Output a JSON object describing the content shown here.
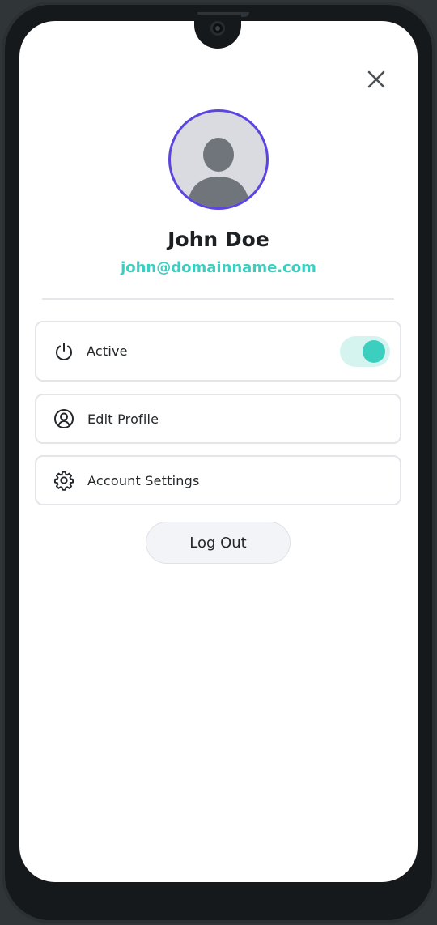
{
  "profile": {
    "name": "John Doe",
    "email": "john@domainname.com",
    "avatar_icon": "user-placeholder-icon"
  },
  "menu": {
    "active": {
      "label": "Active",
      "icon": "power-icon",
      "toggle_on": true
    },
    "edit_profile": {
      "label": "Edit Profile",
      "icon": "user-circle-icon"
    },
    "account_settings": {
      "label": "Account Settings",
      "icon": "gear-icon"
    }
  },
  "actions": {
    "logout_label": "Log Out",
    "close_icon": "close-icon"
  },
  "colors": {
    "accent": "#3ccfc0",
    "avatar_ring": "#5a45e0",
    "toggle_track": "#d5f4f0"
  }
}
